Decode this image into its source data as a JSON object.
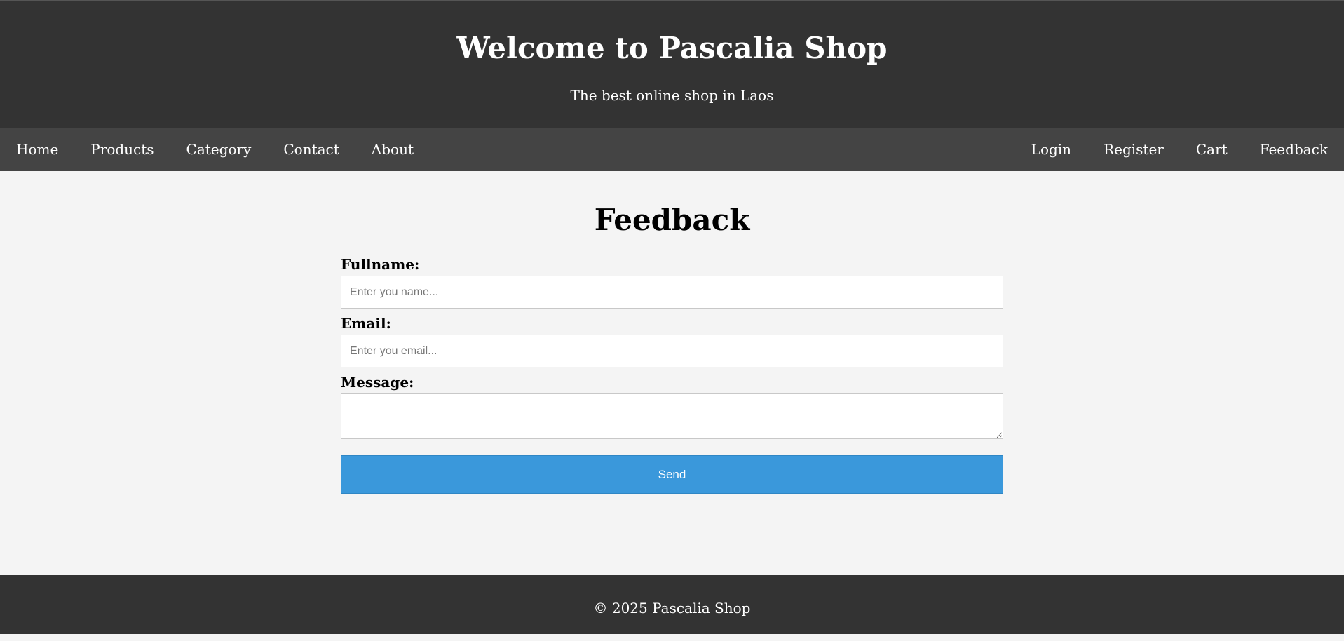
{
  "header": {
    "title": "Welcome to Pascalia Shop",
    "subtitle": "The best online shop in Laos"
  },
  "nav": {
    "left": [
      "Home",
      "Products",
      "Category",
      "Contact",
      "About"
    ],
    "right": [
      "Login",
      "Register",
      "Cart",
      "Feedback"
    ]
  },
  "page": {
    "title": "Feedback"
  },
  "form": {
    "fullname_label": "Fullname:",
    "fullname_placeholder": "Enter you name...",
    "email_label": "Email:",
    "email_placeholder": "Enter you email...",
    "message_label": "Message:",
    "message_value": "",
    "send_label": "Send"
  },
  "footer": {
    "text": "© 2025 Pascalia Shop"
  },
  "colors": {
    "header_bg": "#333333",
    "nav_bg": "#444444",
    "page_bg": "#f4f4f4",
    "button_bg": "#3a98db"
  }
}
